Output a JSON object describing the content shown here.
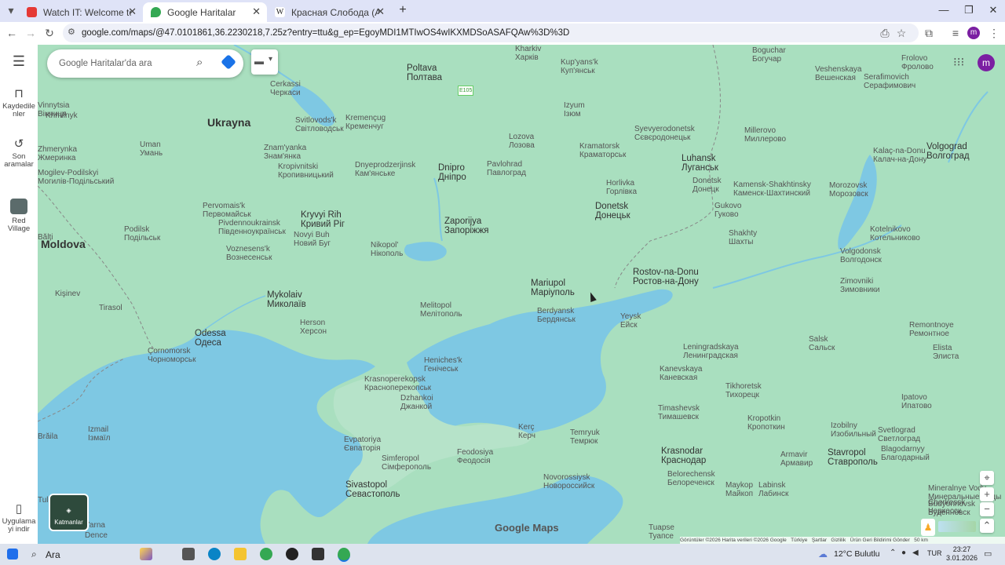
{
  "browser": {
    "tabs": [
      {
        "title": "Watch IT: Welcome to Derry Se",
        "icon": "youtube-icon",
        "color": "#e53935"
      },
      {
        "title": "Google Haritalar",
        "icon": "maps-icon",
        "color": "#34a853"
      },
      {
        "title": "Красная Слобода (Азербайдж",
        "icon": "wikipedia-icon",
        "color": "#555555"
      }
    ],
    "new_tab": "+",
    "url": "google.com/maps/@47.0101861,36.2230218,7.25z?entry=ttu&g_ep=EgoyMDI1MTIwOS4wIKXMDSoASAFQAw%3D%3D"
  },
  "sidebar": {
    "menu": "☰",
    "items": [
      {
        "label": "Kaydedilenler",
        "line1": "Kaydedile",
        "line2": "nler",
        "icon": "bookmark-icon"
      },
      {
        "label": "Son aramalar",
        "line1": "Son",
        "line2": "aramalar",
        "icon": "history-icon"
      },
      {
        "label": "Red Village",
        "line1": "Red",
        "line2": "Village",
        "icon": "place-thumb-icon"
      },
      {
        "label": "Uygulamayı indir",
        "line1": "Uygulama",
        "line2": "yi indir",
        "icon": "phone-icon"
      }
    ]
  },
  "search": {
    "placeholder": "Google Haritalar'da ara"
  },
  "user": {
    "initial": "m",
    "color": "#7b1fa2"
  },
  "layers_button": "Katmanlar",
  "map": {
    "country_labels": [
      "Ukrayna",
      "Moldova"
    ],
    "cities": [
      {
        "lat": "Poltava",
        "cyr": "Полтава"
      },
      {
        "lat": "Cerkassi",
        "cyr": "Черкаси"
      },
      {
        "lat": "Kremençug",
        "cyr": "Кременчуг"
      },
      {
        "lat": "Svitlovods'k",
        "cyr": "Світловодськ"
      },
      {
        "lat": "Uman",
        "cyr": "Умань"
      },
      {
        "lat": "Znam'yanka",
        "cyr": "Знам'янка"
      },
      {
        "lat": "Kropivnitski",
        "cyr": "Кропивницький"
      },
      {
        "lat": "Dnyeprodzerjinsk",
        "cyr": "Кам'янське"
      },
      {
        "lat": "Dnipro",
        "cyr": "Дніпро"
      },
      {
        "lat": "Pavlohrad",
        "cyr": "Павлоград"
      },
      {
        "lat": "Lozova",
        "cyr": "Лозова"
      },
      {
        "lat": "Izyum",
        "cyr": "Ізюм"
      },
      {
        "lat": "Kup'yans'k",
        "cyr": "Куп'янськ"
      },
      {
        "lat": "Kramatorsk",
        "cyr": "Краматорськ"
      },
      {
        "lat": "Syevyerodonetsk",
        "cyr": "Сєвєродонецьк"
      },
      {
        "lat": "Luhansk",
        "cyr": "Луганськ"
      },
      {
        "lat": "Horlivka",
        "cyr": "Горлівка"
      },
      {
        "lat": "Donetsk",
        "cyr": "Донецьк"
      },
      {
        "lat": "Pervomais'k",
        "cyr": "Первомайськ"
      },
      {
        "lat": "Kryvyi Rih",
        "cyr": "Кривий Ріг"
      },
      {
        "lat": "Zaporijya",
        "cyr": "Запоріжжя"
      },
      {
        "lat": "Nikopol'",
        "cyr": "Нікополь"
      },
      {
        "lat": "Pivdennoukrainsk",
        "cyr": "Південноукраїнськ"
      },
      {
        "lat": "Novyi Buh",
        "cyr": "Новий Буг"
      },
      {
        "lat": "Voznesens'k",
        "cyr": "Вознесенськ"
      },
      {
        "lat": "Podilsk",
        "cyr": "Подільськ"
      },
      {
        "lat": "Mykolaiv",
        "cyr": "Миколаїв"
      },
      {
        "lat": "Melitopol",
        "cyr": "Мелітополь"
      },
      {
        "lat": "Mariupol",
        "cyr": "Маріуполь"
      },
      {
        "lat": "Berdyansk",
        "cyr": "Бердянськ"
      },
      {
        "lat": "Rostov-na-Donu",
        "cyr": "Ростов-на-Дону"
      },
      {
        "lat": "Odessa",
        "cyr": "Одеса"
      },
      {
        "lat": "Herson",
        "cyr": "Херсон"
      },
      {
        "lat": "Çornomorsk",
        "cyr": "Чорноморськ"
      },
      {
        "lat": "Heniches'k",
        "cyr": "Генічеськ"
      },
      {
        "lat": "Krasnoperekopsk",
        "cyr": "Красноперекопськ"
      },
      {
        "lat": "Dzhankoi",
        "cyr": "Джанкой"
      },
      {
        "lat": "Evpatoriya",
        "cyr": "Євпаторія"
      },
      {
        "lat": "Simferopol",
        "cyr": "Сімферополь"
      },
      {
        "lat": "Feodosiya",
        "cyr": "Феодосія"
      },
      {
        "lat": "Kerç",
        "cyr": "Керч"
      },
      {
        "lat": "Temryuk",
        "cyr": "Темрюк"
      },
      {
        "lat": "Sivastopol",
        "cyr": "Севастополь"
      },
      {
        "lat": "Novorossiysk",
        "cyr": "Новороссийск"
      },
      {
        "lat": "Krasnodar",
        "cyr": "Краснодар"
      },
      {
        "lat": "Yeysk",
        "cyr": "Ейск"
      },
      {
        "lat": "Kanevskaya",
        "cyr": "Каневская"
      },
      {
        "lat": "Leningradskaya",
        "cyr": "Ленинградская"
      },
      {
        "lat": "Tikhoretsk",
        "cyr": "Тихорецк"
      },
      {
        "lat": "Timashevsk",
        "cyr": "Тимашевск"
      },
      {
        "lat": "Belorechensk",
        "cyr": "Белореченск"
      },
      {
        "lat": "Maykop",
        "cyr": "Майкоп"
      },
      {
        "lat": "Labinsk",
        "cyr": "Лабинск"
      },
      {
        "lat": "Kropotkin",
        "cyr": "Кропоткин"
      },
      {
        "lat": "Armavir",
        "cyr": "Армавир"
      },
      {
        "lat": "Stavropol",
        "cyr": "Ставрополь"
      },
      {
        "lat": "Izobilny",
        "cyr": "Изобильный"
      },
      {
        "lat": "Svetlograd",
        "cyr": "Светлоград"
      },
      {
        "lat": "Blagodarnyy",
        "cyr": "Благодарный"
      },
      {
        "lat": "Ipatovo",
        "cyr": "Ипатово"
      },
      {
        "lat": "Salsk",
        "cyr": "Сальск"
      },
      {
        "lat": "Remontnoye",
        "cyr": "Ремонтное"
      },
      {
        "lat": "Elista",
        "cyr": "Элиста"
      },
      {
        "lat": "Zimovniki",
        "cyr": "Зимовники"
      },
      {
        "lat": "Volgodonsk",
        "cyr": "Волгодонск"
      },
      {
        "lat": "Kotelnikovo",
        "cyr": "Котельниково"
      },
      {
        "lat": "Shakhty",
        "cyr": "Шахты"
      },
      {
        "lat": "Kamensk-Shakhtinsky",
        "cyr": "Каменск-Шахтинский"
      },
      {
        "lat": "Morozovsk",
        "cyr": "Морозовск"
      },
      {
        "lat": "Gukovo",
        "cyr": "Гуково"
      },
      {
        "lat": "Donetsk",
        "cyr": "Донецк"
      },
      {
        "lat": "Millerovo",
        "cyr": "Миллерово"
      },
      {
        "lat": "Kalaç-na-Donu",
        "cyr": "Калач-на-Дону"
      },
      {
        "lat": "Volgograd",
        "cyr": "Волгоград"
      },
      {
        "lat": "Veshenskaya",
        "cyr": "Вешенская"
      },
      {
        "lat": "Serafimovich",
        "cyr": "Серафимович"
      },
      {
        "lat": "Frolovo",
        "cyr": "Фролово"
      },
      {
        "lat": "Boguchar",
        "cyr": "Богучар"
      },
      {
        "lat": "Kişinev",
        "cyr": ""
      },
      {
        "lat": "Tirasol",
        "cyr": ""
      },
      {
        "lat": "Brăila",
        "cyr": ""
      },
      {
        "lat": "Izmail",
        "cyr": "Ізмаїл"
      },
      {
        "lat": "Tulcea",
        "cyr": ""
      },
      {
        "lat": "Vinnytsia",
        "cyr": "Вінниця"
      },
      {
        "lat": "Zhmerynka",
        "cyr": "Жмеринка"
      },
      {
        "lat": "Khmilnyk",
        "cyr": ""
      },
      {
        "lat": "Budyonnovsk",
        "cyr": "Будённовск"
      },
      {
        "lat": "Cherkessk",
        "cyr": "Черкесск"
      },
      {
        "lat": "Mineralnye Vody",
        "cyr": "Минеральные Воды"
      },
      {
        "lat": "Tuapse",
        "cyr": "Туапсе"
      },
      {
        "lat": "Kharkiv",
        "cyr": "Харків"
      },
      {
        "lat": "Bălți",
        "cyr": ""
      },
      {
        "lat": "Mogilev-Podilskyi",
        "cyr": "Могилів-Подільський"
      },
      {
        "lat": "Yarna",
        "cyr": ""
      },
      {
        "lat": "Dence",
        "cyr": ""
      },
      {
        "lat": "Constance Nord",
        "cyr": ""
      }
    ],
    "road_shield": "E105",
    "brand": "Google Maps"
  },
  "footer": {
    "imagery": "Görüntüler ©2026",
    "data": "Harita verileri ©2026 Google",
    "region": "Türkiye",
    "terms": "Şartlar",
    "privacy": "Gizlilik",
    "feedback": "Ürün Geri Bildirimi Gönder",
    "scale": "50 km"
  },
  "taskbar": {
    "search": "Ara",
    "search_full": "Ara",
    "weather": "12°C  Bulutlu",
    "language": "TUR",
    "time": "23:27",
    "date": "3.01.2026"
  },
  "colors": {
    "land": "#a9dfbf",
    "water": "#7ec8e3",
    "rail_bg": "#ffffff",
    "tabbar": "#dfe3f7"
  }
}
